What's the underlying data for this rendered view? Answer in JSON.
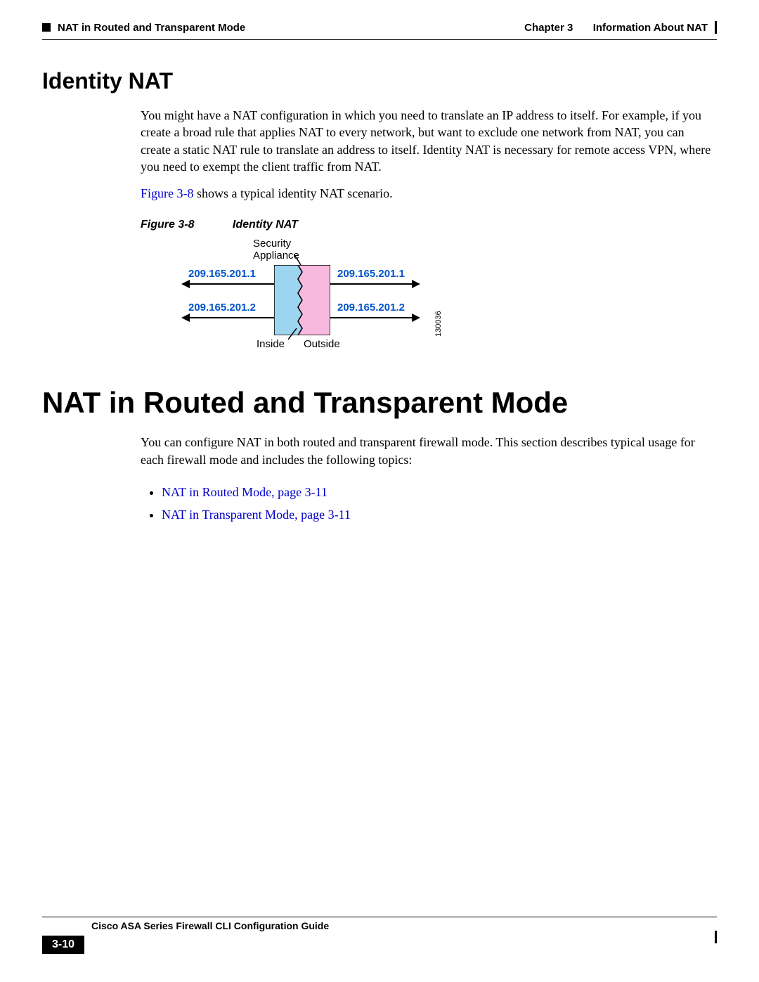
{
  "header": {
    "chapter_label": "Chapter 3",
    "chapter_title": "Information About NAT",
    "section_title": "NAT in Routed and Transparent Mode"
  },
  "section1": {
    "heading": "Identity NAT",
    "para1": "You might have a NAT configuration in which you need to translate an IP address to itself. For example, if you create a broad rule that applies NAT to every network, but want to exclude one network from NAT, you can create a static NAT rule to translate an address to itself. Identity NAT is necessary for remote access VPN, where you need to exempt the client traffic from NAT.",
    "fig_ref": "Figure 3-8",
    "fig_sentence": " shows a typical identity NAT scenario.",
    "figure_label": "Figure 3-8",
    "figure_title": "Identity NAT"
  },
  "figure": {
    "top_label": "Security\nAppliance",
    "ip_left_1": "209.165.201.1",
    "ip_left_2": "209.165.201.2",
    "ip_right_1": "209.165.201.1",
    "ip_right_2": "209.165.201.2",
    "inside": "Inside",
    "outside": "Outside",
    "image_id": "130036"
  },
  "section2": {
    "heading": "NAT in Routed and Transparent Mode",
    "para1": "You can configure NAT in both routed and transparent firewall mode. This section describes typical usage for each firewall mode and includes the following topics:",
    "link1": "NAT in Routed Mode, page 3-11",
    "link2": "NAT in Transparent Mode, page 3-11"
  },
  "footer": {
    "guide_title": "Cisco ASA Series Firewall CLI Configuration Guide",
    "page_number": "3-10"
  }
}
